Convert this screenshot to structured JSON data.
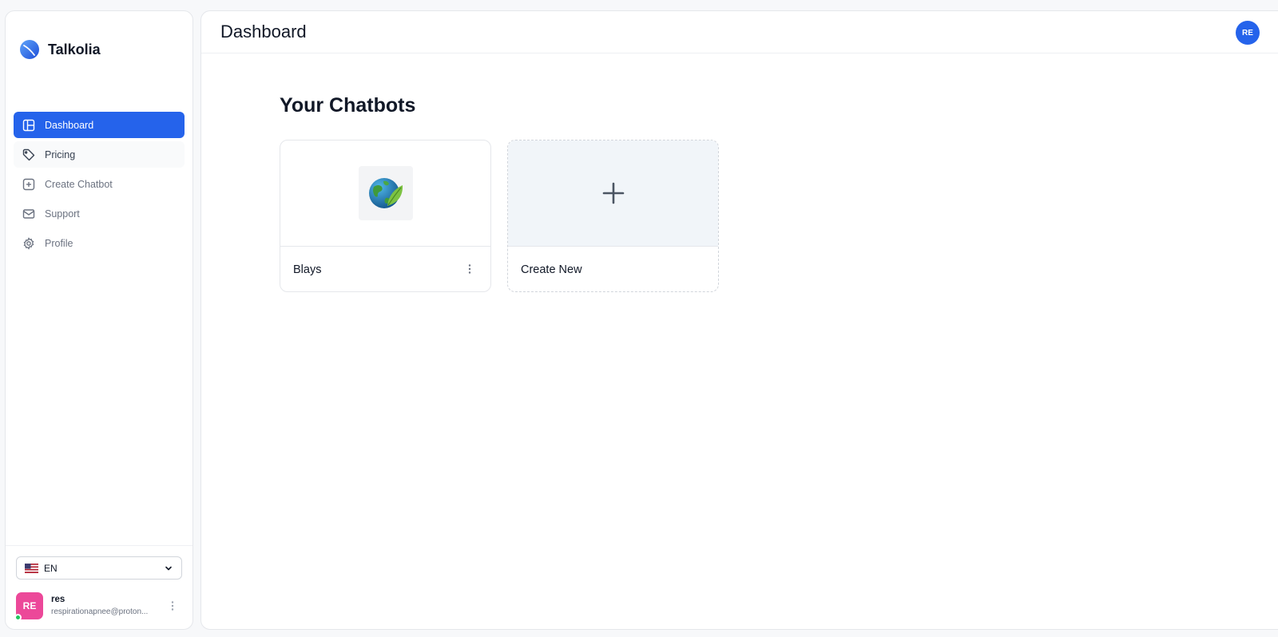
{
  "brand": {
    "name": "Talkolia",
    "color": "#3b82f6"
  },
  "nav": {
    "items": [
      {
        "label": "Dashboard",
        "icon": "layout-icon",
        "active": true
      },
      {
        "label": "Pricing",
        "icon": "tag-icon"
      },
      {
        "label": "Create Chatbot",
        "icon": "plus-square-icon"
      },
      {
        "label": "Support",
        "icon": "mail-icon"
      },
      {
        "label": "Profile",
        "icon": "gear-icon"
      }
    ]
  },
  "language": {
    "selected": "EN",
    "flag": "us-flag-icon"
  },
  "user": {
    "initials": "RE",
    "name": "res",
    "email": "respirationapnee@proton...",
    "avatar_color": "#ec4899",
    "status": "online"
  },
  "header": {
    "title": "Dashboard",
    "avatar_initials": "RE",
    "avatar_color": "#2563eb"
  },
  "main": {
    "section_title": "Your Chatbots",
    "chatbots": [
      {
        "name": "Blays",
        "icon": "earth-leaf-icon"
      }
    ],
    "create_card": {
      "label": "Create New"
    }
  },
  "colors": {
    "accent": "#2563eb",
    "text": "#111827",
    "muted": "#6b7280"
  }
}
